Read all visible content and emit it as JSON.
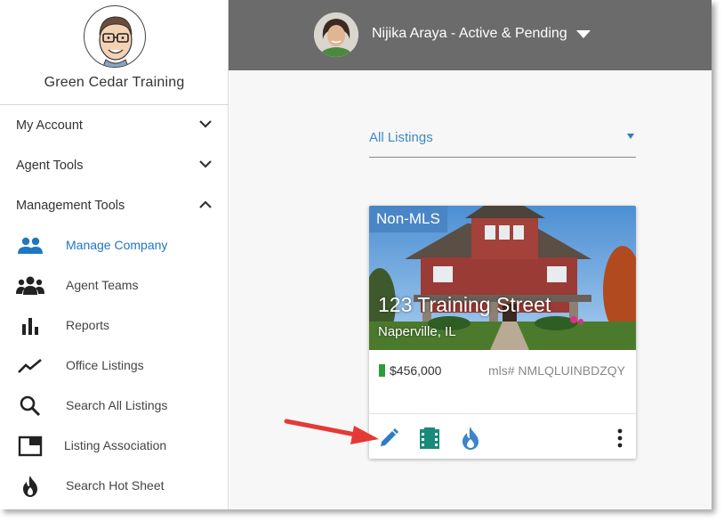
{
  "sidebar": {
    "company_name": "Green Cedar Training",
    "sections": [
      {
        "label": "My Account",
        "state": "collapsed"
      },
      {
        "label": "Agent Tools",
        "state": "collapsed"
      },
      {
        "label": "Management Tools",
        "state": "expanded"
      }
    ],
    "items": [
      {
        "label": "Manage Company",
        "icon": "group-icon",
        "active": true
      },
      {
        "label": "Agent Teams",
        "icon": "team-icon",
        "active": false
      },
      {
        "label": "Reports",
        "icon": "bar-chart-icon",
        "active": false
      },
      {
        "label": "Office Listings",
        "icon": "trend-line-icon",
        "active": false
      },
      {
        "label": "Search All Listings",
        "icon": "search-icon",
        "active": false
      },
      {
        "label": "Listing Association",
        "icon": "window-icon",
        "active": false
      },
      {
        "label": "Search Hot Sheet",
        "icon": "flame-icon",
        "active": false
      }
    ]
  },
  "header": {
    "user_label": "Nijika Araya - Active & Pending"
  },
  "main": {
    "filter": {
      "selected": "All Listings"
    },
    "listing": {
      "badge": "Non-MLS",
      "address": "123 Training Street",
      "city": "Naperville, IL",
      "price": "$456,000",
      "mls": "mls# NMLQLUINBDZQY",
      "status_color": "#2e9b3b",
      "actions": [
        "edit-pencil-icon",
        "film-strip-icon",
        "flame-icon",
        "more-vert-icon"
      ]
    }
  },
  "colors": {
    "accent": "#1f77c0",
    "header_bg": "#6b6b6b",
    "badge_bg": "#4a86c5",
    "arrow": "#e53935"
  }
}
